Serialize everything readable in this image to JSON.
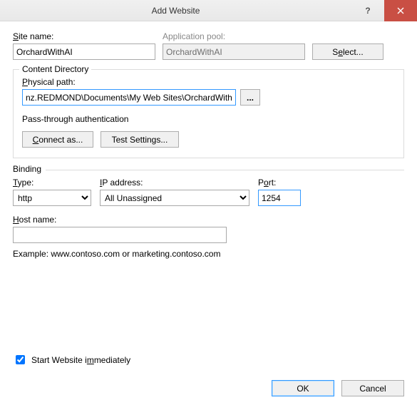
{
  "window": {
    "title": "Add Website"
  },
  "labels": {
    "site_name": "Site name:",
    "app_pool": "Application pool:",
    "select_btn": "Select...",
    "content_dir": "Content Directory",
    "physical_path": "Physical path:",
    "browse": "...",
    "passthrough": "Pass-through authentication",
    "connect_as": "Connect as...",
    "test_settings": "Test Settings...",
    "binding": "Binding",
    "type": "Type:",
    "ip_address": "IP address:",
    "port": "Port:",
    "host_name": "Host name:",
    "example": "Example: www.contoso.com or marketing.contoso.com",
    "start_immediately": "Start Website immediately",
    "ok": "OK",
    "cancel": "Cancel",
    "help": "?"
  },
  "values": {
    "site_name": "OrchardWithAI",
    "app_pool": "OrchardWithAI",
    "physical_path": "nz.REDMOND\\Documents\\My Web Sites\\OrchardWithAI",
    "type": "http",
    "ip_address": "All Unassigned",
    "port": "1254",
    "host_name": "",
    "start_immediately_checked": true
  }
}
